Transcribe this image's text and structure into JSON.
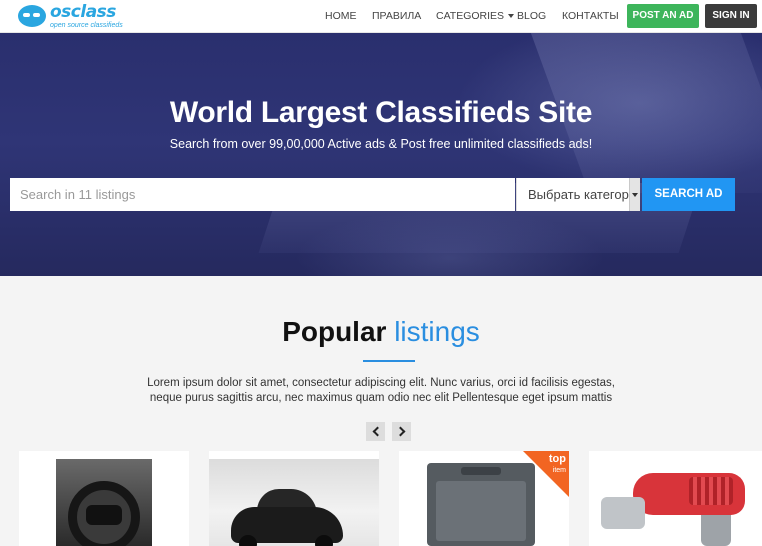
{
  "header": {
    "logo": {
      "name": "osclass",
      "tagline": "open source classifieds"
    },
    "nav": {
      "home": "HOME",
      "rules": "ПРАВИЛА",
      "categories": "CATEGORIES",
      "blog": "BLOG",
      "contacts": "КОНТАКТЫ"
    },
    "post_ad": "POST AN AD",
    "sign_in": "SIGN IN",
    "colors": {
      "post_ad_bg": "#3db55b",
      "sign_in_bg": "#3b3b3b"
    }
  },
  "hero": {
    "title": "World Largest Classifieds Site",
    "subtitle": "Search from over 99,00,000 Active ads & Post free unlimited classifieds ads!",
    "search": {
      "placeholder": "Search in 11 listings",
      "value": "",
      "category_selected": "Выбрать категорию",
      "button": "SEARCH AD",
      "button_color": "#2196f3"
    }
  },
  "popular": {
    "title_bold": "Popular",
    "title_light": "listings",
    "accent_color": "#2a8ee0",
    "description": "Lorem ipsum dolor sit amet, consectetur adipiscing elit. Nunc varius, orci id facilisis egestas, neque purus sagittis arcu, nec maximus quam odio nec elit Pellentesque eget ipsum mattis",
    "prev_icon": "chevron-left-icon",
    "next_icon": "chevron-right-icon",
    "listings": [
      {
        "image": "car-steering-wheel-photo"
      },
      {
        "image": "black-sedan-in-snow-photo"
      },
      {
        "image": "toolbox-set-photo",
        "badge_main": "top",
        "badge_sub": "item",
        "badge_color": "#f26522"
      },
      {
        "image": "heat-gun-photo"
      }
    ]
  }
}
